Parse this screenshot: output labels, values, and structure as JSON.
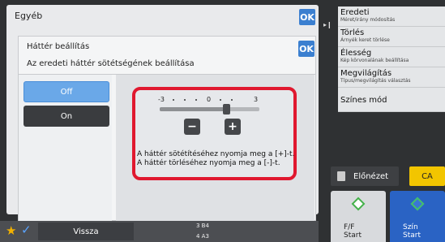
{
  "outer_dialog": {
    "title": "Egyéb",
    "ok_label": "OK"
  },
  "inner_dialog": {
    "title": "Háttér beállítás",
    "ok_label": "OK",
    "subtitle": "Az eredeti háttér sötétségének beállítása",
    "options": {
      "off": "Off",
      "on": "On",
      "selected": "Off"
    }
  },
  "slider": {
    "labels": [
      "-3",
      "0",
      "3"
    ],
    "value": 1,
    "min": -3,
    "max": 3,
    "minus_label": "−",
    "plus_label": "+"
  },
  "help_text": {
    "line1": "A háttér sötétítéséhez nyomja meg a [+]-t.",
    "line2": "A háttér törléséhez nyomja meg a [-]-t."
  },
  "menu": [
    {
      "label": "Eredeti",
      "sub": "Méret/irány módosítás"
    },
    {
      "label": "Törlés",
      "sub": "Árnyék keret törlése"
    },
    {
      "label": "Élesség",
      "sub": "Kép körvonalának beállítása"
    },
    {
      "label": "Megvilágítás",
      "sub": "Típus/megvilágítás választás"
    },
    {
      "label": "Színes mód",
      "sub": ""
    }
  ],
  "preview_label": "Előnézet",
  "ca_label": "CA",
  "start_ff": {
    "line1": "F/F",
    "line2": "Start"
  },
  "start_color": {
    "line1": "Szín",
    "line2": "Start"
  },
  "bottom": {
    "back_label": "Vissza",
    "tray_top": "3  B4",
    "tray_bottom": "4  A3"
  },
  "colors": {
    "accent_red": "#e0182f",
    "ok_blue": "#3b7fd0",
    "ca_yellow": "#f2c500",
    "start_blue": "#2a63c4"
  }
}
